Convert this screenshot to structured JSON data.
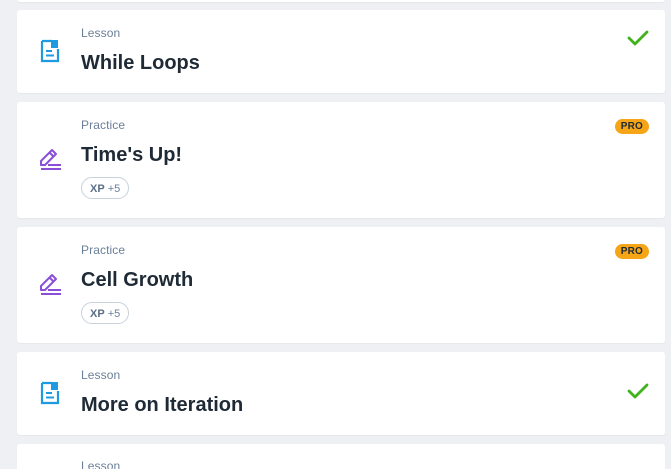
{
  "items": [
    {
      "kind": "Lesson",
      "title": "While Loops",
      "status": "completed",
      "icon": "lesson-document-icon"
    },
    {
      "kind": "Practice",
      "title": "Time's Up!",
      "xp_label": "XP",
      "xp_value": "+5",
      "badge": "PRO",
      "icon": "practice-pencil-icon"
    },
    {
      "kind": "Practice",
      "title": "Cell Growth",
      "xp_label": "XP",
      "xp_value": "+5",
      "badge": "PRO",
      "icon": "practice-pencil-icon"
    },
    {
      "kind": "Lesson",
      "title": "More on Iteration",
      "status": "completed",
      "icon": "lesson-document-icon"
    },
    {
      "kind": "Lesson",
      "title": "",
      "icon": "lesson-document-icon"
    }
  ],
  "colors": {
    "lesson_icon": "#1e9be0",
    "practice_icon": "#8a4fd8",
    "check": "#3fb21c",
    "pro_badge": "#f5a516",
    "background": "#eef0f3"
  }
}
